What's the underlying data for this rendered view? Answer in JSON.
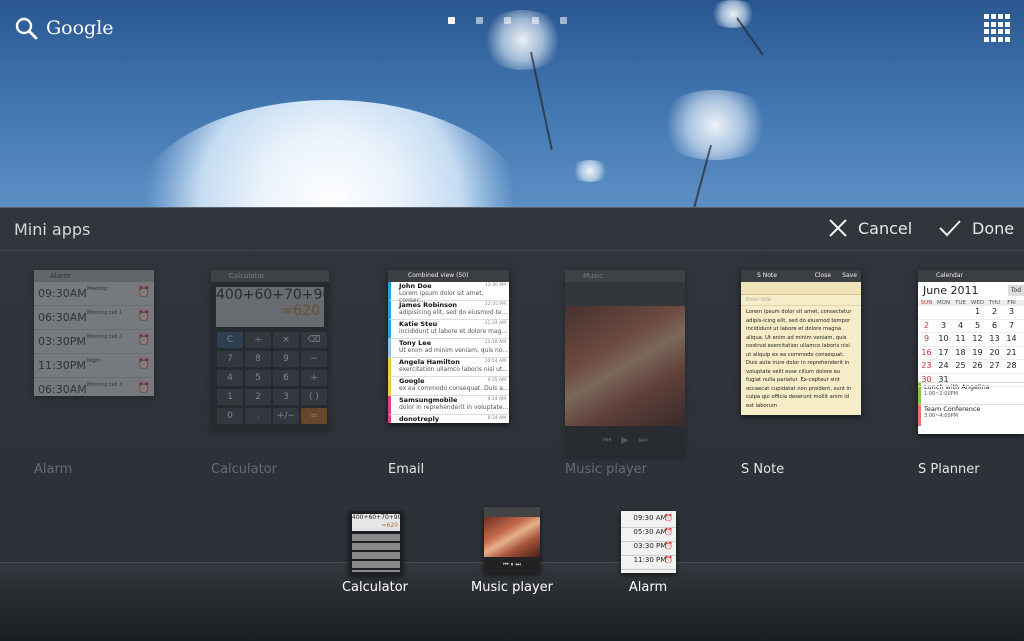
{
  "search": {
    "label": "Google",
    "icon": "search-icon"
  },
  "launcher": {
    "icon": "app-grid-icon",
    "page_count": 5,
    "active_page": 1
  },
  "panel": {
    "title": "Mini apps",
    "cancel_label": "Cancel",
    "done_label": "Done"
  },
  "apps": [
    {
      "name": "Alarm",
      "state": "dim"
    },
    {
      "name": "Calculator",
      "state": "dim"
    },
    {
      "name": "Email",
      "state": "bright"
    },
    {
      "name": "Music player",
      "state": "dim"
    },
    {
      "name": "S Note",
      "state": "bright"
    },
    {
      "name": "S Planner",
      "state": "bright"
    }
  ],
  "alarm_thumb": {
    "title": "Alarm",
    "rows": [
      {
        "time": "09:30AM",
        "label": "Meeting"
      },
      {
        "time": "06:30AM",
        "label": "Morning call 1"
      },
      {
        "time": "03:30PM",
        "label": "Morning call 2"
      },
      {
        "time": "11:30PM",
        "label": "Night"
      },
      {
        "time": "06:30AM",
        "label": "Morning call 3"
      }
    ]
  },
  "calc_thumb": {
    "title": "Calculator",
    "expression": "400+60+70+90",
    "result": "=620",
    "keys": [
      "C",
      "÷",
      "×",
      "⌫",
      "7",
      "8",
      "9",
      "−",
      "4",
      "5",
      "6",
      "+",
      "1",
      "2",
      "3",
      "( )",
      "0",
      ".",
      "+/−",
      "="
    ]
  },
  "email_thumb": {
    "title": "Combined view (50)",
    "messages": [
      {
        "from": "John Doe",
        "snippet": "Lorem ipsum dolor sit amet, consec...",
        "time": "12:30 PM"
      },
      {
        "from": "James Robinson",
        "snippet": "adipisicing elit, sed do eiusmod te...",
        "time": "12:05 PM"
      },
      {
        "from": "Katie Steu",
        "snippet": "incididunt ut labore et dolore mag...",
        "time": "11:34 AM"
      },
      {
        "from": "Tony Lee",
        "snippet": "Ut enim ad minim veniam, quis no...",
        "time": "11:18 AM"
      },
      {
        "from": "Angela Hamilton",
        "snippet": "exercitation ullamco laboris nisi ut...",
        "time": "10:54 AM"
      },
      {
        "from": "Google",
        "snippet": "ex ea commodo consequat. Duis a...",
        "time": "9:35 AM"
      },
      {
        "from": "Samsungmobile",
        "snippet": "dolor in reprehenderit in voluptate...",
        "time": "9:14 AM"
      },
      {
        "from": "donotreply",
        "snippet": "",
        "time": "8:34 AM"
      }
    ]
  },
  "music_thumb": {
    "title": "Music"
  },
  "snote_thumb": {
    "title": "S Note",
    "close": "Close",
    "save": "Save",
    "field": "Enter title",
    "body": "Lorem ipsum dolor sit amet, consectetur adipis-icing elit, sed do eiusmod tempor incididunt ut labore et dolore magna aliqua. Ut enim ad minim veniam, quis nostrud exercitation ullamco laboris nisi ut aliquip ex ea commodo consequat. Duis aute irure dolor in reprehenderit in voluptate velit esse cillum dolore eu fugiat nulla pariatur. Ex-cepteur sint occaecat cupidatat non proident, sunt in culpa qui officia deserunt mollit anim id est laborum"
  },
  "planner_thumb": {
    "title": "Calendar",
    "month": "June 2011",
    "today": "Tod",
    "weekdays": [
      "SUN",
      "MON",
      "TUE",
      "WED",
      "THU",
      "FRI"
    ],
    "weeks": [
      [
        "",
        "",
        "",
        "1",
        "2",
        "3"
      ],
      [
        "2",
        "3",
        "4",
        "5",
        "6",
        "7"
      ],
      [
        "9",
        "10",
        "11",
        "12",
        "13",
        "14"
      ],
      [
        "16",
        "17",
        "18",
        "19",
        "20",
        "21"
      ],
      [
        "23",
        "24",
        "25",
        "26",
        "27",
        "28"
      ],
      [
        "30",
        "31",
        "",
        "",
        "",
        ""
      ]
    ],
    "events": [
      {
        "title": "Lunch with Angelina",
        "time": "1:00~2:00PM"
      },
      {
        "title": "Team Conference",
        "time": "3:00~4:00PM"
      }
    ]
  },
  "dock": [
    {
      "name": "Calculator",
      "expression": "400+60+70+90",
      "result": "=620"
    },
    {
      "name": "Music player"
    },
    {
      "name": "Alarm",
      "times": [
        "09:30 AM",
        "05:30 AM",
        "03:30 PM",
        "11:30 PM"
      ]
    }
  ]
}
